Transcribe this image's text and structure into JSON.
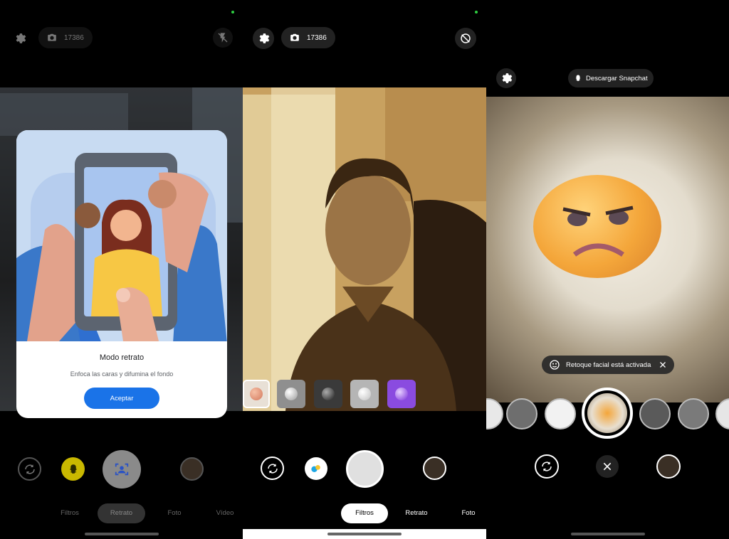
{
  "panel1": {
    "counter": "17386",
    "dialog": {
      "title": "Modo retrato",
      "description": "Enfoca las caras y difumina el fondo",
      "accept_label": "Aceptar"
    },
    "modes": [
      {
        "label": "Filtros",
        "active": false
      },
      {
        "label": "Retrato",
        "active": true
      },
      {
        "label": "Foto",
        "active": false
      },
      {
        "label": "Vídeo",
        "active": false
      }
    ],
    "icons": {
      "settings": "gear-icon",
      "camera": "camera-icon",
      "flash": "flash-off-icon",
      "switch": "switch-camera-icon",
      "snapchat": "snapchat-icon",
      "shutter": "portrait-face-icon",
      "gallery": "gallery-thumbnail"
    }
  },
  "panel2": {
    "counter": "17386",
    "modes": [
      {
        "label": "Filtros",
        "active": true
      },
      {
        "label": "Retrato",
        "active": false
      },
      {
        "label": "Foto",
        "active": false
      }
    ],
    "filters": [
      "peach",
      "silver",
      "dark",
      "light-silver",
      "violet"
    ],
    "colors": {
      "peach": "#e2957b",
      "silver": "#bdbdbd",
      "dark": "#4b4b4b",
      "light_silver": "#d6d6d6",
      "violet": "#9b5be8"
    }
  },
  "panel3": {
    "snapchat_label": "Descargar Snapchat",
    "toast": "Retoque facial está activada"
  }
}
